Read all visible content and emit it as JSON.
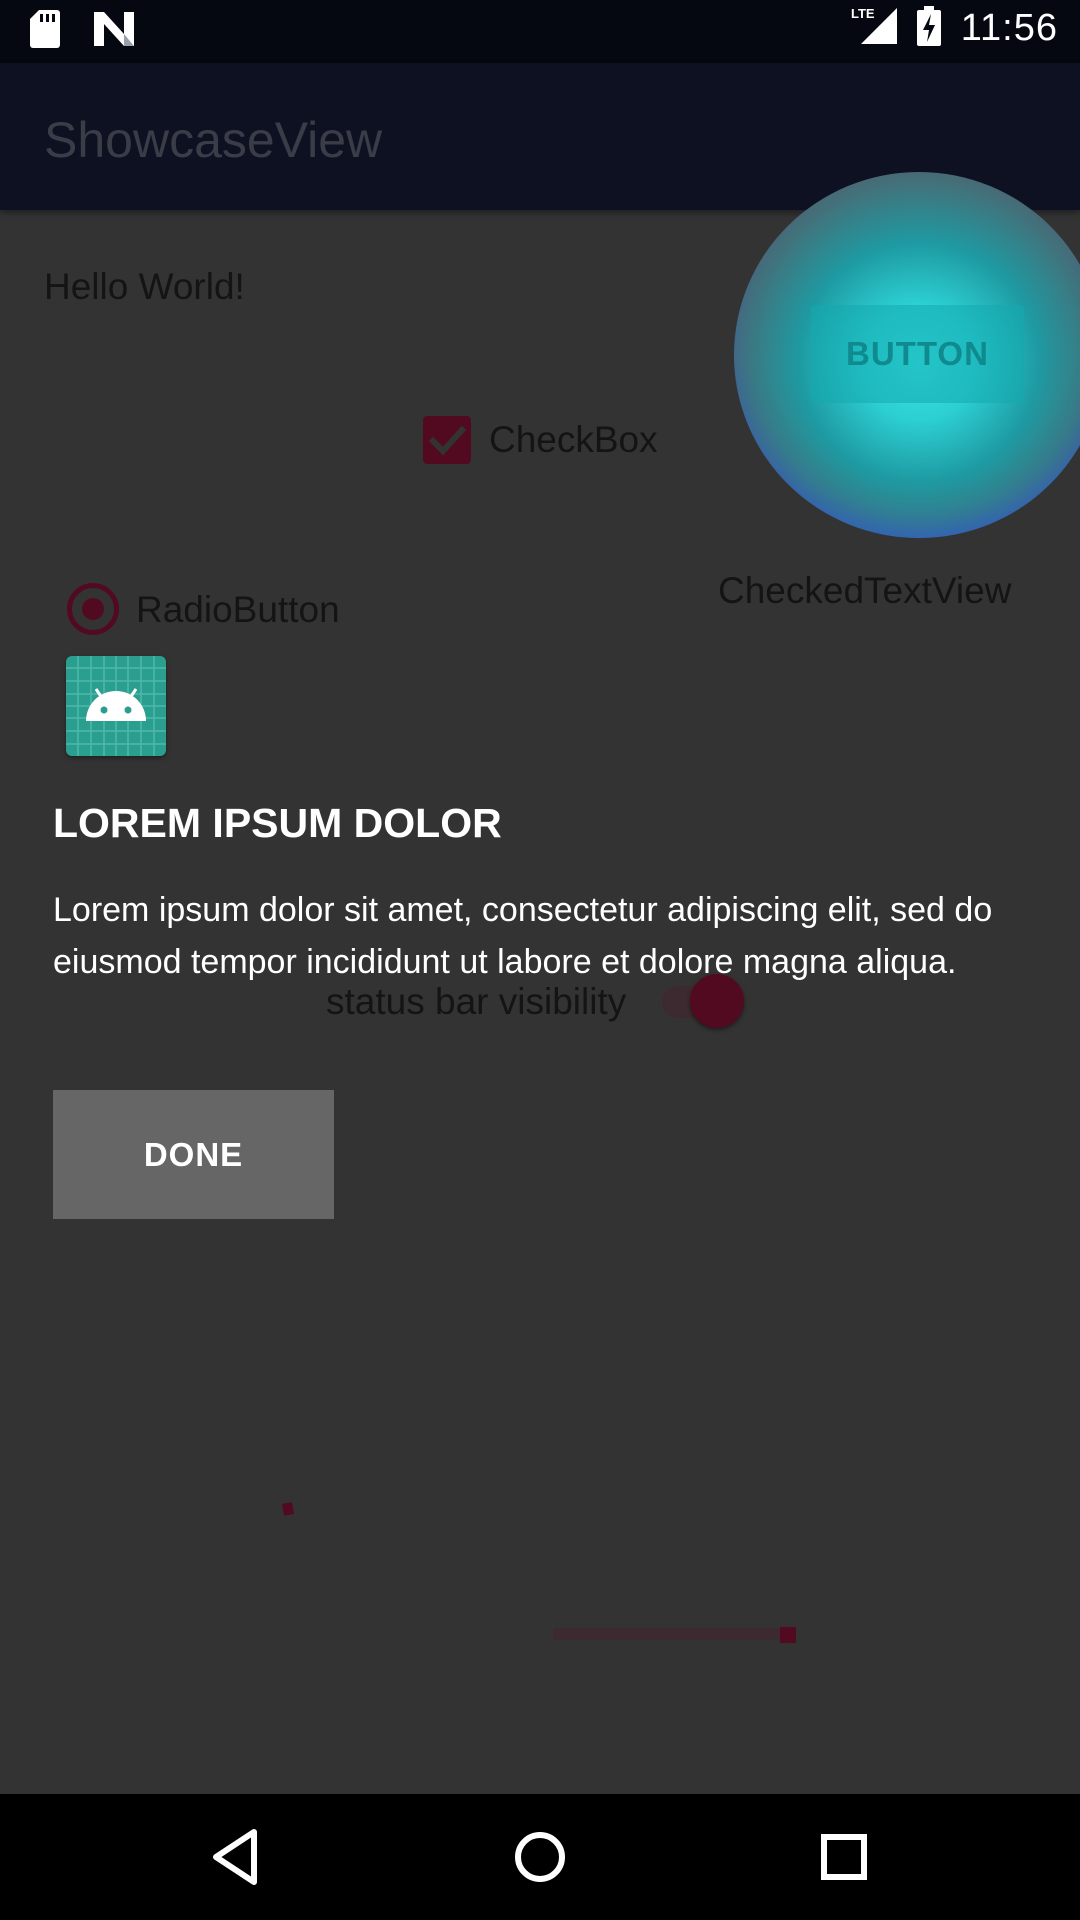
{
  "status_bar": {
    "time": "11:56",
    "network": "LTE",
    "icons": [
      "sd-card-icon",
      "n-logo-icon",
      "lte-signal-icon",
      "battery-charging-icon"
    ]
  },
  "app_bar": {
    "title": "ShowcaseView"
  },
  "content": {
    "hello_text": "Hello World!",
    "button_label": "BUTTON",
    "checkbox_label": "CheckBox",
    "checkbox_checked": true,
    "checked_text_view": "CheckedTextView",
    "radio_label": "RadioButton",
    "radio_selected": true,
    "switch_label": "status bar visibility",
    "switch_on": true
  },
  "showcase": {
    "title": "LOREM IPSUM DOLOR",
    "body": "Lorem ipsum dolor sit amet, consectetur adipiscing elit, sed do eiusmod tempor incididunt ut labore et dolore magna aliqua.",
    "done_label": "DONE"
  },
  "colors": {
    "accent": "#520a21",
    "spotlight": "#38e6e6",
    "overlay": "#333333"
  },
  "nav_bar": {
    "icons": [
      "back-icon",
      "home-icon",
      "recents-icon"
    ]
  }
}
